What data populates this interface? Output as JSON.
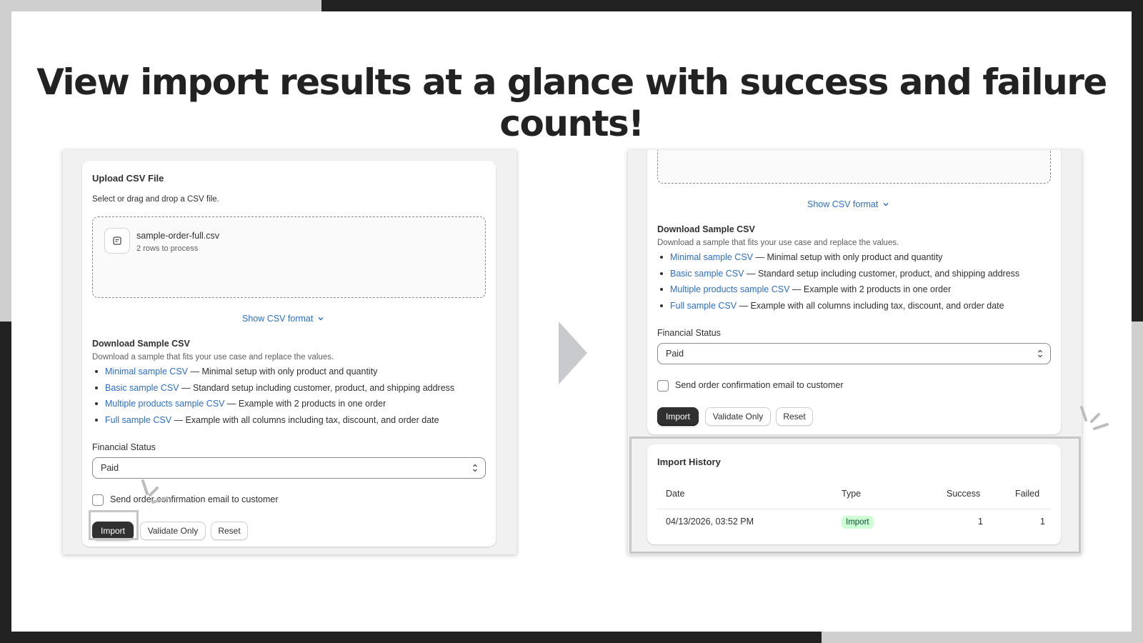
{
  "headline": "View import results at a glance with success and failure counts!",
  "colors": {
    "dark": "#222222",
    "light_gray": "#cfcfcf",
    "link": "#2c6ecb",
    "primary_button": "#303030",
    "success_badge_bg": "#cdfed4",
    "success_badge_text": "#0c5132"
  },
  "left_panel": {
    "card_title": "Upload CSV File",
    "card_subtitle": "Select or drag and drop a CSV file.",
    "file": {
      "icon": "file-icon",
      "name": "sample-order-full.csv",
      "meta": "2 rows to process"
    },
    "show_csv_format": "Show CSV format",
    "download_title": "Download Sample CSV",
    "download_subtitle": "Download a sample that fits your use case and replace the values.",
    "samples": [
      {
        "link": "Minimal sample CSV",
        "desc": " — Minimal setup with only product and quantity"
      },
      {
        "link": "Basic sample CSV",
        "desc": " — Standard setup including customer, product, and shipping address"
      },
      {
        "link": "Multiple products sample CSV",
        "desc": " — Example with 2 products in one order"
      },
      {
        "link": "Full sample CSV",
        "desc": " — Example with all columns including tax, discount, and order date"
      }
    ],
    "financial_status_label": "Financial Status",
    "financial_status_value": "Paid",
    "send_email_label": "Send order confirmation email to customer",
    "buttons": {
      "import": "Import",
      "validate": "Validate Only",
      "reset": "Reset"
    }
  },
  "right_panel": {
    "show_csv_format": "Show CSV format",
    "download_title": "Download Sample CSV",
    "download_subtitle": "Download a sample that fits your use case and replace the values.",
    "samples": [
      {
        "link": "Minimal sample CSV",
        "desc": " — Minimal setup with only product and quantity"
      },
      {
        "link": "Basic sample CSV",
        "desc": " — Standard setup including customer, product, and shipping address"
      },
      {
        "link": "Multiple products sample CSV",
        "desc": " — Example with 2 products in one order"
      },
      {
        "link": "Full sample CSV",
        "desc": " — Example with all columns including tax, discount, and order date"
      }
    ],
    "financial_status_label": "Financial Status",
    "financial_status_value": "Paid",
    "send_email_label": "Send order confirmation email to customer",
    "buttons": {
      "import": "Import",
      "validate": "Validate Only",
      "reset": "Reset"
    },
    "history": {
      "title": "Import History",
      "columns": [
        "Date",
        "Type",
        "Success",
        "Failed"
      ],
      "rows": [
        {
          "date": "04/13/2026, 03:52 PM",
          "type": "Import",
          "success": "1",
          "failed": "1"
        }
      ]
    }
  }
}
